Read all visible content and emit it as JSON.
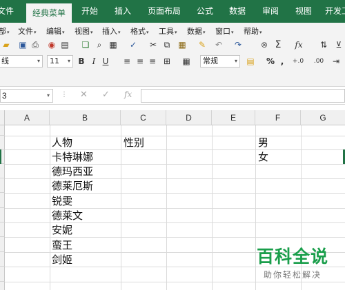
{
  "ribbon_tabs": [
    "文件",
    "经典菜单",
    "开始",
    "插入",
    "页面布局",
    "公式",
    "数据",
    "审阅",
    "视图",
    "开发工"
  ],
  "active_tab": "经典菜单",
  "classic_menu": [
    "部",
    "文件",
    "编辑",
    "视图",
    "插入",
    "格式",
    "工具",
    "数据",
    "窗口",
    "帮助"
  ],
  "toolbar1_icons": [
    "open-icon",
    "save-icon",
    "print-icon",
    "print-preview-icon",
    "permission-icon",
    "save-as-icon",
    "copy-page-icon",
    "zoom-icon",
    "spelling-icon",
    "cut-icon",
    "copy-icon",
    "paste-icon",
    "format-painter-icon",
    "undo-icon",
    "redo-icon",
    "hyperlink-icon",
    "autosum-icon",
    "function-icon",
    "sort-icon"
  ],
  "toolbar2": {
    "font_name": "线",
    "font_size": "11",
    "bold": "B",
    "italic": "I",
    "underline": "U",
    "number_format": "常规",
    "percent": "%",
    "comma": ",",
    "increase_decimal": "+.0",
    "decrease_decimal": ".00"
  },
  "formula_bar": {
    "name_box": "3",
    "fx": "fx",
    "value": ""
  },
  "columns": [
    "A",
    "B",
    "C",
    "D",
    "E",
    "F",
    "G"
  ],
  "cells": {
    "B1": "人物",
    "C1": "性别",
    "F1": "男",
    "B2": "卡特琳娜",
    "F2": "女",
    "B3": "德玛西亚",
    "B4": "德莱厄斯",
    "B5": "锐雯",
    "B6": "德莱文",
    "B7": "安妮",
    "B8": "蛮王",
    "B9": "剑姬"
  },
  "watermark": {
    "title": "百科全说",
    "subtitle": "助你轻松解决"
  },
  "colors": {
    "ribbon": "#217346",
    "watermark": "#1a9e4b"
  }
}
